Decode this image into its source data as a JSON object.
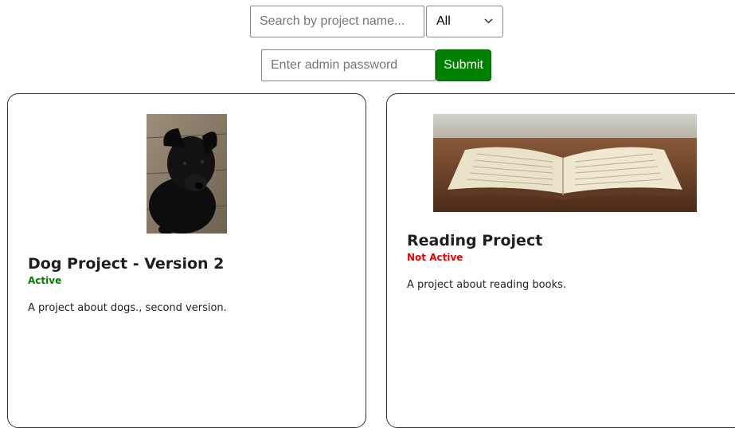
{
  "search": {
    "placeholder": "Search by project name..."
  },
  "filter": {
    "selected": "All"
  },
  "admin": {
    "password_placeholder": "Enter admin password",
    "submit_label": "Submit"
  },
  "projects": [
    {
      "title": "Dog Project - Version 2",
      "status": "Active",
      "description": "A project about dogs., second version.",
      "image": "black-dog-photo"
    },
    {
      "title": "Reading Project",
      "status": "Not Active",
      "description": "A project about reading books.",
      "image": "open-book-photo"
    }
  ],
  "colors": {
    "active": "#008000",
    "inactive": "#ee0000",
    "submit_bg": "#008000"
  }
}
